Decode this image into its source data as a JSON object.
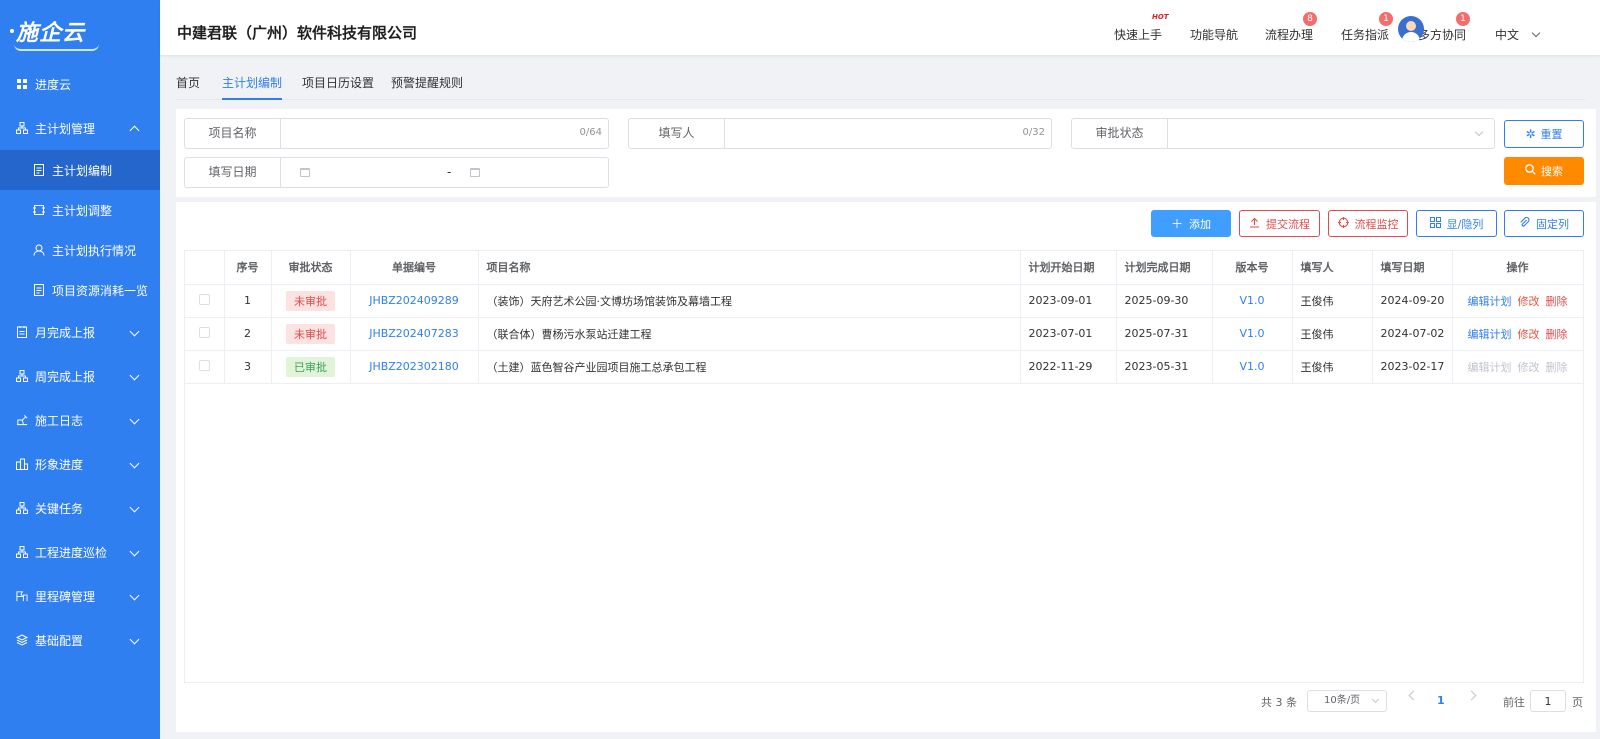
{
  "app": {
    "logo": "施企云"
  },
  "sidebar": {
    "items": [
      {
        "label": "进度云",
        "icon": "grid-icon",
        "expandable": false
      },
      {
        "label": "主计划管理",
        "icon": "org-icon",
        "expandable": true,
        "expanded": true,
        "children": [
          {
            "label": "主计划编制",
            "icon": "doc-icon",
            "active": true
          },
          {
            "label": "主计划调整",
            "icon": "adjust-icon",
            "active": false
          },
          {
            "label": "主计划执行情况",
            "icon": "user-icon",
            "active": false
          },
          {
            "label": "项目资源消耗一览",
            "icon": "doc-icon",
            "active": false
          }
        ]
      },
      {
        "label": "月完成上报",
        "icon": "report-icon",
        "expandable": true
      },
      {
        "label": "周完成上报",
        "icon": "org-icon",
        "expandable": true
      },
      {
        "label": "施工日志",
        "icon": "machine-icon",
        "expandable": true
      },
      {
        "label": "形象进度",
        "icon": "progress-icon",
        "expandable": true
      },
      {
        "label": "关键任务",
        "icon": "org-icon",
        "expandable": true
      },
      {
        "label": "工程进度巡检",
        "icon": "org-icon",
        "expandable": true
      },
      {
        "label": "里程碑管理",
        "icon": "milestone-icon",
        "expandable": true
      },
      {
        "label": "基础配置",
        "icon": "layers-icon",
        "expandable": true
      }
    ]
  },
  "header": {
    "company": "中建君联（广州）软件科技有限公司",
    "nav": [
      {
        "label": "快速上手",
        "tag": "HOT"
      },
      {
        "label": "功能导航"
      },
      {
        "label": "流程办理",
        "badge": "8"
      },
      {
        "label": "任务指派",
        "badge": "1"
      },
      {
        "label": "多方协同",
        "badge": "1"
      }
    ],
    "language": "中文"
  },
  "tabs": [
    {
      "label": "首页",
      "active": false
    },
    {
      "label": "主计划编制",
      "active": true
    },
    {
      "label": "项目日历设置",
      "active": false
    },
    {
      "label": "预警提醒规则",
      "active": false
    }
  ],
  "filters": {
    "project_name": {
      "label": "项目名称",
      "value": "",
      "count": "0/64"
    },
    "filler": {
      "label": "填写人",
      "value": "",
      "count": "0/32"
    },
    "approval_status": {
      "label": "审批状态",
      "value": ""
    },
    "fill_date": {
      "label": "填写日期",
      "separator": "-"
    },
    "reset_label": "重置",
    "search_label": "搜索"
  },
  "toolbar": {
    "add": "添加",
    "submit_flow": "提交流程",
    "monitor_flow": "流程监控",
    "toggle_columns": "显/隐列",
    "fix_columns": "固定列"
  },
  "table": {
    "columns": [
      "",
      "序号",
      "审批状态",
      "单据编号",
      "项目名称",
      "计划开始日期",
      "计划完成日期",
      "版本号",
      "填写人",
      "填写日期",
      "操作"
    ],
    "rows": [
      {
        "index": "1",
        "status": "未审批",
        "status_type": "pending",
        "code": "JHBZ202409289",
        "project": "（装饰）天府艺术公园·文博坊场馆装饰及幕墙工程",
        "start": "2023-09-01",
        "end": "2025-09-30",
        "version": "V1.0",
        "filler": "王俊伟",
        "fill_date": "2024-09-20",
        "ops_enabled": true
      },
      {
        "index": "2",
        "status": "未审批",
        "status_type": "pending",
        "code": "JHBZ202407283",
        "project": "（联合体）曹杨污水泵站迁建工程",
        "start": "2023-07-01",
        "end": "2025-07-31",
        "version": "V1.0",
        "filler": "王俊伟",
        "fill_date": "2024-07-02",
        "ops_enabled": true
      },
      {
        "index": "3",
        "status": "已审批",
        "status_type": "approved",
        "code": "JHBZ202302180",
        "project": "（土建）蓝色智谷产业园项目施工总承包工程",
        "start": "2022-11-29",
        "end": "2023-05-31",
        "version": "V1.0",
        "filler": "王俊伟",
        "fill_date": "2023-02-17",
        "ops_enabled": false
      }
    ],
    "ops": {
      "edit_plan": "编辑计划",
      "modify": "修改",
      "delete": "删除"
    }
  },
  "pagination": {
    "total": "共 3 条",
    "page_size": "10条/页",
    "current_page": "1",
    "goto_label": "前往",
    "goto_value": "1",
    "page_unit": "页"
  },
  "colors": {
    "sidebar": "#2f7ff0",
    "sidebar_active": "#2566cc",
    "primary": "#2f7ff0",
    "search": "#ff8a00",
    "danger": "#e04b4b",
    "success": "#3ca05a"
  }
}
